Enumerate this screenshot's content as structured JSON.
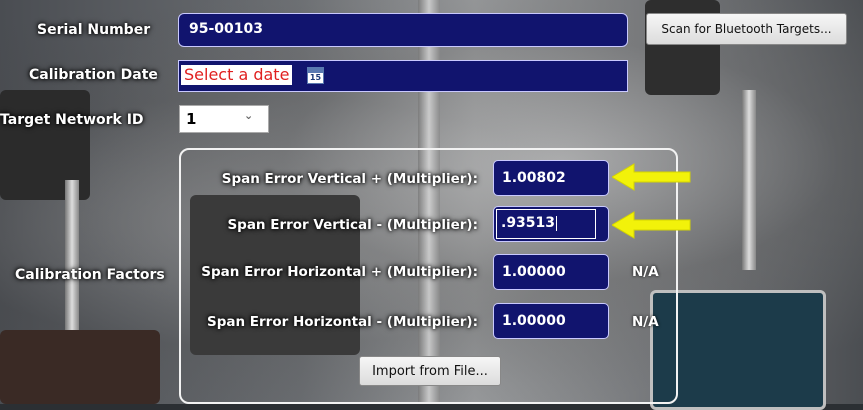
{
  "form": {
    "serial_number": {
      "label": "Serial Number",
      "value": "95-00103"
    },
    "scan_button": "Scan for Bluetooth Targets...",
    "calibration_date": {
      "label": "Calibration Date",
      "placeholder": "Select a date",
      "calendar_icon_text": "15"
    },
    "target_network_id": {
      "label": "Target Network ID",
      "selected": "1"
    },
    "calibration_factors": {
      "label": "Calibration Factors",
      "rows": [
        {
          "label": "Span Error Vertical + (Multiplier):",
          "value": "1.00802",
          "note": ""
        },
        {
          "label": "Span Error Vertical - (Multiplier):",
          "value": ".93513",
          "note": ""
        },
        {
          "label": "Span Error Horizontal + (Multiplier):",
          "value": "1.00000",
          "note": "N/A"
        },
        {
          "label": "Span Error Horizontal - (Multiplier):",
          "value": "1.00000",
          "note": "N/A"
        }
      ],
      "import_button": "Import from File..."
    }
  },
  "annotations": {
    "arrow_color": "#f2f20a"
  }
}
